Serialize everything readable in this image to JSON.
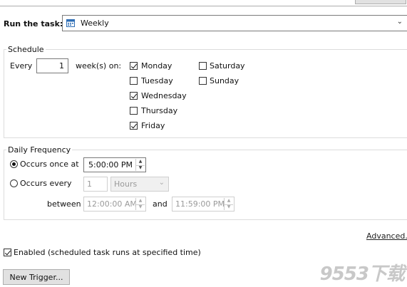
{
  "run_task": {
    "label": "Run the task:",
    "value": "Weekly",
    "calendar_icon": "calendar-icon"
  },
  "schedule": {
    "group_label": "Schedule",
    "every_label": "Every",
    "every_value": "1",
    "weeks_on_label": "week(s) on:",
    "days": [
      {
        "label": "Monday",
        "checked": true
      },
      {
        "label": "Tuesday",
        "checked": false
      },
      {
        "label": "Wednesday",
        "checked": true
      },
      {
        "label": "Thursday",
        "checked": false
      },
      {
        "label": "Friday",
        "checked": true
      },
      {
        "label": "Saturday",
        "checked": false
      },
      {
        "label": "Sunday",
        "checked": false
      }
    ]
  },
  "daily": {
    "group_label": "Daily Frequency",
    "once_label": "Occurs once at",
    "once_time": "5:00:00 PM",
    "every_label": "Occurs every",
    "every_value": "1",
    "unit": "Hours",
    "between_label": "between",
    "start_time": "12:00:00 AM",
    "and_label": "and",
    "end_time": "11:59:00 PM",
    "selected": "once"
  },
  "advanced_link": "Advanced...",
  "enabled": {
    "label": "Enabled (scheduled task runs at specified time)",
    "checked": true
  },
  "new_trigger": "New Trigger...",
  "watermark": "9553下载"
}
